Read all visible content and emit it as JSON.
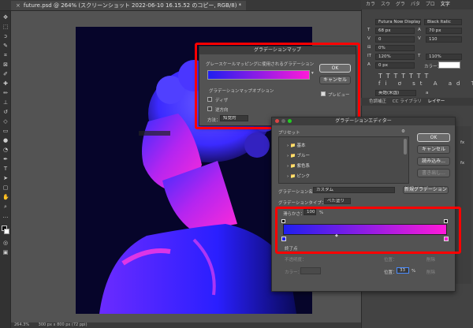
{
  "document_tab": {
    "title": "future.psd @ 264% (スクリーンショット 2022-06-10 16.15.52 のコピー, RGB/8) *",
    "close": "×"
  },
  "status_bar": {
    "zoom": "264.3%",
    "size": "300 px x 800 px (72 ppi)"
  },
  "right_panel": {
    "tabs": [
      "カラ",
      "スウ",
      "グラ",
      "パタ",
      "プロ",
      "文字"
    ],
    "font_family": "Futura Now Display",
    "font_style": "Black Italic",
    "font_size": "68 px",
    "leading": "70 px",
    "kerning": "0",
    "tracking": "110",
    "percent": "0%",
    "vscale": "120%",
    "hscale": "110%",
    "baseline": "0 px",
    "color_label": "カラー：",
    "lang": "英語(米国)",
    "lang_aa": "a",
    "lower_tabs": [
      "色調補正",
      "CC ライブラリ",
      "レイヤー"
    ],
    "lower_tab_active": "レイヤー"
  },
  "gradient_map_dialog": {
    "title": "グラデーションマップ",
    "section_label": "グレースケールマッピングに使用されるグラデーション",
    "ok": "OK",
    "cancel": "キャンセル",
    "preview": "プレビュー",
    "options_label": "グラデーションマップオプション",
    "dither": "ディザ",
    "reverse": "逆方向",
    "method_label": "方法：",
    "method_value": "知覚的"
  },
  "gradient_editor": {
    "title": "グラデーションエディター",
    "presets_label": "プリセット",
    "presets": [
      "基本",
      "ブルー",
      "紫色系",
      "ピンク"
    ],
    "ok": "OK",
    "cancel": "キャンセル",
    "load": "読み込み...",
    "save": "書き出し...",
    "name_label": "グラデーション名：",
    "name_value": "カスタム",
    "new_button": "新規グラデーション",
    "type_label": "グラデーションタイプ：",
    "type_value": "べた塗り",
    "smoothness_label": "滑らかさ：",
    "smoothness_value": "100",
    "smoothness_unit": "%",
    "stops_label": "終了点",
    "opacity_label": "不透明度：",
    "location_label": "位置：",
    "delete_label": "削除",
    "color_label": "カラー：",
    "location_value": "33",
    "location_unit": "%",
    "color_hex": {
      "start": "#1f1ff0",
      "end": "#ff1ad9"
    }
  }
}
